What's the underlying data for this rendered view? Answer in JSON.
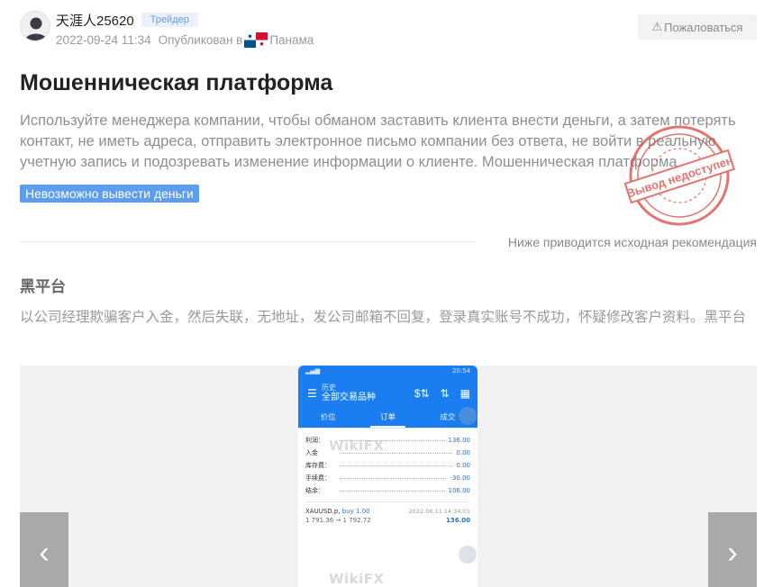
{
  "post": {
    "username": "天涯人25620",
    "role": "Трейдер",
    "date": "2022-09-24 11:34",
    "published_in": "Опубликован в",
    "country": "Панама",
    "report_label": "Пожаловаться",
    "title": "Мошенническая платформа",
    "description": "Используйте менеджера компании, чтобы обманом заставить клиента внести деньги, а затем потерять контакт, не иметь адреса, отправить электронное письмо компании без ответа, не войти в реальную учетную запись и подозревать изменение информации о клиенте. Мошенническая платформа",
    "tag": "Невозможно вывести деньги",
    "stamp_text": "Вывод недоступен",
    "original_note": "Ниже приводится исходная рекомендация",
    "original_title": "黑平台",
    "original_body": "以公司经理欺骗客户入金，然后失联，无地址，发公司邮箱不回复，登录真实账号不成功，怀疑修改客户资料。黑平台"
  },
  "gallery": {
    "prev_icon": "chevron-left-icon",
    "next_icon": "chevron-right-icon"
  },
  "screenshot": {
    "status_time": "20:54",
    "title_small": "历史",
    "title_main": "全部交易品种",
    "tabs": [
      "价位",
      "订单",
      "成交"
    ],
    "rows": [
      {
        "label": "利润：",
        "value": "136.00"
      },
      {
        "label": "入金",
        "value": "0.00"
      },
      {
        "label": "库存费：",
        "value": "0.00"
      },
      {
        "label": "手续费：",
        "value": "-30.00"
      },
      {
        "label": "结余：",
        "value": "106.00"
      }
    ],
    "trade": {
      "symbol": "XAUUSD.p,",
      "side": "buy 1.00",
      "date": "2022.06.11 14:34:01",
      "prices": "1 791.36 → 1 792.72",
      "profit": "136.00"
    },
    "watermark": "WikiFX"
  },
  "colors": {
    "accent_blue": "#1a7ef0",
    "tag_blue": "#5c9ded",
    "stamp_red": "#d9473f"
  }
}
